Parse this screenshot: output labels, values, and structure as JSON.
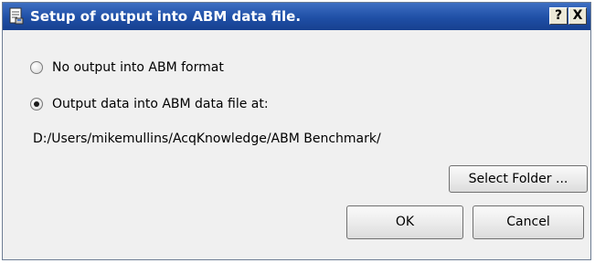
{
  "window": {
    "title": "Setup of output into ABM data file.",
    "help_label": "?",
    "close_label": "X",
    "icon": "setup-document-icon"
  },
  "options": {
    "no_output_label": "No output into ABM format",
    "output_label": "Output data into ABM data file at:",
    "selected": "output"
  },
  "path": "D:/Users/mikemullins/AcqKnowledge/ABM Benchmark/",
  "buttons": {
    "select_folder": "Select Folder ...",
    "ok": "OK",
    "cancel": "Cancel"
  },
  "colors": {
    "titlebar": "#1f4fa6",
    "dialog_background": "#f0f0f0"
  }
}
